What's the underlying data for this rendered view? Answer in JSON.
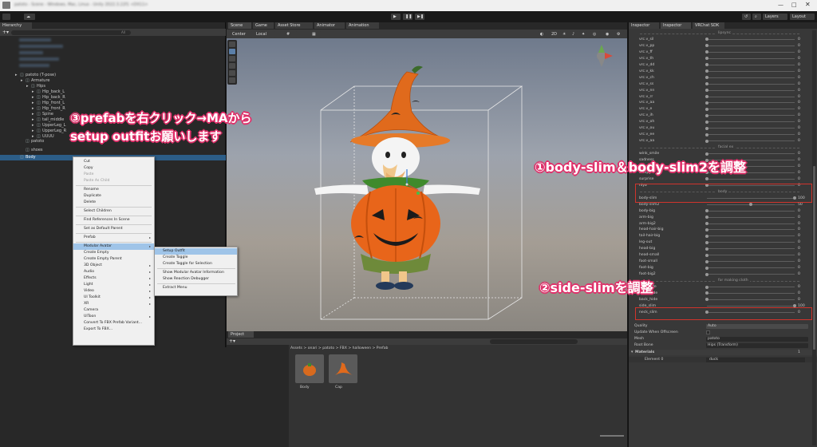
{
  "titlebar": {
    "blurred_label": "patoto - Scene - Windows, Mac, Linux - Unity 2022.3.22f1 <DX11>"
  },
  "toolbar": {
    "layers_label": "Layers",
    "layout_label": "Layout"
  },
  "hierarchy": {
    "tab_label": "Hierarchy",
    "search_placeholder": "All",
    "rows": [
      {
        "label": "patoto (T-pose)",
        "indent": 1
      },
      {
        "label": "Armature",
        "indent": 2
      },
      {
        "label": "Hips",
        "indent": 3
      },
      {
        "label": "Hip_back_L",
        "indent": 4
      },
      {
        "label": "Hip_back_R",
        "indent": 4
      },
      {
        "label": "Hip_front_L",
        "indent": 4
      },
      {
        "label": "Hip_front_R",
        "indent": 4
      },
      {
        "label": "Spine",
        "indent": 4
      },
      {
        "label": "tail_middle",
        "indent": 4
      },
      {
        "label": "UpperLeg_L",
        "indent": 4
      },
      {
        "label": "UpperLeg_R",
        "indent": 4
      },
      {
        "label": "UUUU",
        "indent": 4
      },
      {
        "label": "patoto",
        "indent": 2
      },
      {
        "label": "shoes",
        "indent": 2
      },
      {
        "label": "Body",
        "indent": 1
      }
    ]
  },
  "context_menu": {
    "items": [
      {
        "label": "Cut"
      },
      {
        "label": "Copy"
      },
      {
        "label": "Paste",
        "disabled": true
      },
      {
        "label": "Paste As Child",
        "disabled": true
      },
      {
        "sep": true
      },
      {
        "label": "Rename"
      },
      {
        "label": "Duplicate"
      },
      {
        "label": "Delete"
      },
      {
        "sep": true
      },
      {
        "label": "Select Children"
      },
      {
        "sep": true
      },
      {
        "label": "Find References In Scene"
      },
      {
        "sep": true
      },
      {
        "label": "Set as Default Parent"
      },
      {
        "sep": true
      },
      {
        "label": "Prefab",
        "sub": true
      },
      {
        "sep": true
      },
      {
        "label": "Modular Avatar",
        "sub": true,
        "selected": true
      },
      {
        "label": "Create Empty"
      },
      {
        "label": "Create Empty Parent"
      },
      {
        "label": "3D Object",
        "sub": true
      },
      {
        "label": "Audio",
        "sub": true
      },
      {
        "label": "Effects",
        "sub": true
      },
      {
        "label": "Light",
        "sub": true
      },
      {
        "label": "Video",
        "sub": true
      },
      {
        "label": "UI Toolkit",
        "sub": true
      },
      {
        "label": "XR",
        "sub": true
      },
      {
        "label": "Camera"
      },
      {
        "label": "UIToon",
        "sub": true
      },
      {
        "label": "Convert To FBX Prefab Variant..."
      },
      {
        "label": "Export To FBX..."
      }
    ]
  },
  "submenu": {
    "items": [
      {
        "label": "Setup Outfit",
        "selected": true
      },
      {
        "label": "Create Toggle"
      },
      {
        "label": "Create Toggle for Selection"
      },
      {
        "sep": true
      },
      {
        "label": "Show Modular Avatar Information"
      },
      {
        "label": "Show Reaction Debugger"
      },
      {
        "sep": true
      },
      {
        "label": "Extract Menu"
      }
    ]
  },
  "scene": {
    "tabs": [
      "Scene",
      "Game",
      "Asset Store",
      "Animator",
      "Animation"
    ],
    "center_label": "Center",
    "local_label": "Local",
    "mode_2d": "2D"
  },
  "project": {
    "tab_label": "Project",
    "breadcrumb": "Assets > onari > patoto > FBX > halloween > Prefab",
    "assets": [
      "Body",
      "Cap"
    ]
  },
  "inspector": {
    "tabs": [
      "Inspector",
      "Inspector",
      "VRChat SDK"
    ],
    "rows": [
      {
        "section": "lipsync"
      },
      {
        "name": "vrc.v_sil",
        "value": 0
      },
      {
        "name": "vrc.v_pp",
        "value": 0
      },
      {
        "name": "vrc.v_ff",
        "value": 0
      },
      {
        "name": "vrc.v_th",
        "value": 0
      },
      {
        "name": "vrc.v_dd",
        "value": 0
      },
      {
        "name": "vrc.v_kk",
        "value": 0
      },
      {
        "name": "vrc.v_ch",
        "value": 0
      },
      {
        "name": "vrc.v_ss",
        "value": 0
      },
      {
        "name": "vrc.v_nn",
        "value": 0
      },
      {
        "name": "vrc.v_rr",
        "value": 0
      },
      {
        "name": "vrc.v_aa",
        "value": 0
      },
      {
        "name": "vrc.v_e",
        "value": 0
      },
      {
        "name": "vrc.v_ih",
        "value": 0
      },
      {
        "name": "vrc.v_oh",
        "value": 0
      },
      {
        "name": "vrc.v_ou",
        "value": 0
      },
      {
        "name": "vrc.v_ee",
        "value": 0
      },
      {
        "name": "vrc.v_aa",
        "value": 0
      },
      {
        "section": "facial ex"
      },
      {
        "name": "wink_smile",
        "value": 0
      },
      {
        "name": "sadness",
        "value": 0
      },
      {
        "name": "angry",
        "value": 0
      },
      {
        "name": "sleepy",
        "value": 0
      },
      {
        "name": "surprise",
        "value": 0
      },
      {
        "name": "niya",
        "value": 0
      },
      {
        "section": "body"
      },
      {
        "name": "body-slim",
        "value": 100
      },
      {
        "name": "body-slim2",
        "value": 50
      },
      {
        "name": "body-big",
        "value": 0
      },
      {
        "name": "arm-big",
        "value": 0
      },
      {
        "name": "arm-big2",
        "value": 0
      },
      {
        "name": "head-hair-big",
        "value": 0
      },
      {
        "name": "tail-hair-big",
        "value": 0
      },
      {
        "name": "leg-out",
        "value": 0
      },
      {
        "name": "head-big",
        "value": 0
      },
      {
        "name": "head-small",
        "value": 0
      },
      {
        "name": "foot-small",
        "value": 0
      },
      {
        "name": "foot-big",
        "value": 0
      },
      {
        "name": "foot-big2",
        "value": 0
      },
      {
        "section": "for making cloth"
      },
      {
        "name": "hips_hide",
        "value": 0
      },
      {
        "name": "front_hide",
        "value": 0
      },
      {
        "name": "back_hide",
        "value": 0
      },
      {
        "name": "side_slim",
        "value": 100
      },
      {
        "name": "neck_slim",
        "value": 0
      }
    ],
    "props": [
      {
        "name": "Quality",
        "value": "Auto"
      },
      {
        "name": "Update When Offscreen",
        "value": ""
      },
      {
        "name": "Mesh",
        "value": "patoto"
      },
      {
        "name": "Root Bone",
        "value": "Hips (Transform)"
      }
    ],
    "materials_label": "Materials",
    "materials_count": "1",
    "element0_label": "Element 0",
    "element0_value": "duck"
  },
  "annotations": {
    "step1": "①body-slim＆body-slim2を調整",
    "step2": "②side-slimを調整",
    "step3_line1": "③prefabを右クリック→MAから",
    "step3_line2": "setup outfitお願いします"
  },
  "colors": {
    "accent_pink": "#e0306a",
    "selection_blue": "#2c5d87",
    "menu_highlight": "#9fc4e8",
    "redbox": "#d0342c"
  }
}
